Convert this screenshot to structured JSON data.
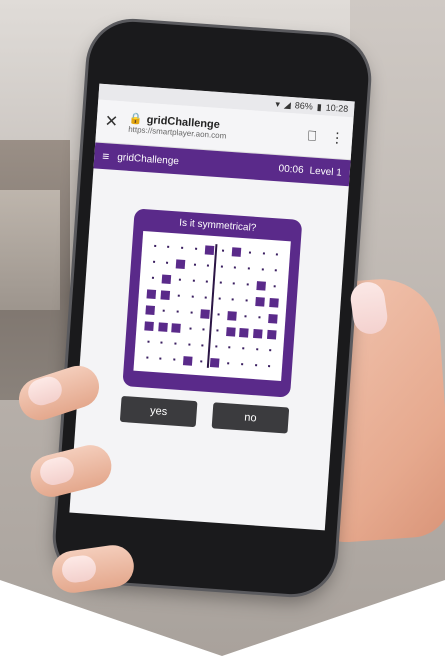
{
  "browser": {
    "status": {
      "battery": "86%",
      "time": "10:28"
    },
    "tab_title": "gridChallenge",
    "url": "https://smartplayer.aon.com"
  },
  "app": {
    "title": "gridChallenge",
    "timer": "00:06",
    "level": "Level 1"
  },
  "puzzle": {
    "question": "Is it symmetrical?",
    "grid": [
      [
        0,
        0,
        0,
        0,
        1,
        0,
        1,
        0,
        0,
        0
      ],
      [
        0,
        0,
        1,
        0,
        0,
        0,
        0,
        0,
        0,
        0
      ],
      [
        0,
        1,
        0,
        0,
        0,
        0,
        0,
        0,
        1,
        0
      ],
      [
        1,
        1,
        0,
        0,
        0,
        0,
        0,
        0,
        1,
        1
      ],
      [
        1,
        0,
        0,
        0,
        1,
        0,
        1,
        0,
        0,
        1
      ],
      [
        1,
        1,
        1,
        0,
        0,
        0,
        1,
        1,
        1,
        1
      ],
      [
        0,
        0,
        0,
        0,
        0,
        0,
        0,
        0,
        0,
        0
      ],
      [
        0,
        0,
        0,
        1,
        0,
        1,
        0,
        0,
        0,
        0
      ]
    ]
  },
  "buttons": {
    "yes": "yes",
    "no": "no"
  },
  "colors": {
    "brand_purple": "#5a2a8a",
    "button_dark": "#3b3b3e"
  }
}
